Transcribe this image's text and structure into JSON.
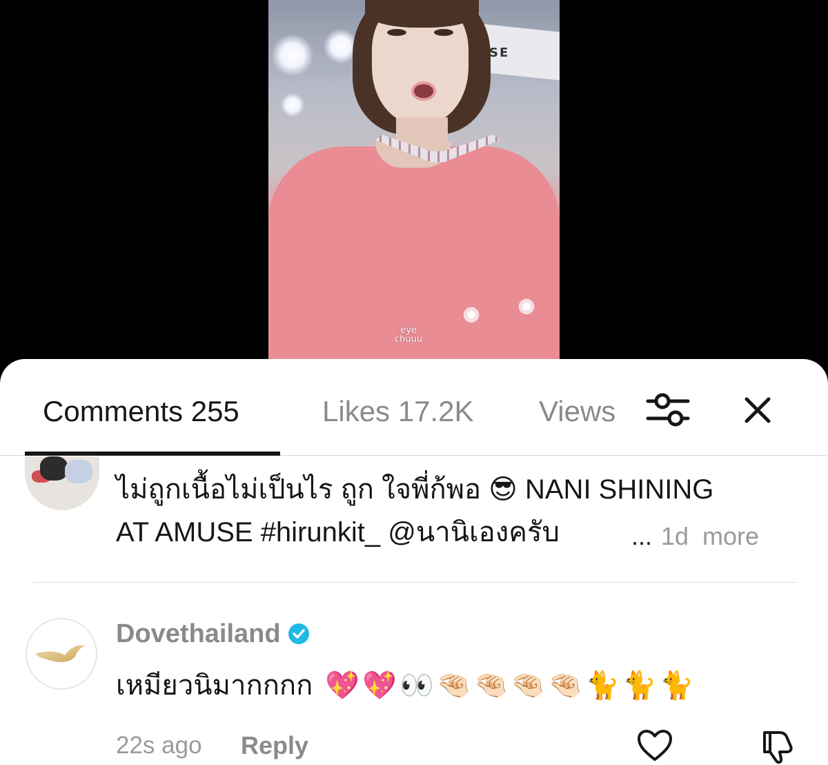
{
  "video": {
    "watermark_top": "eye",
    "watermark_bottom": "chuuu",
    "banner_text": "SE"
  },
  "tabs": [
    {
      "label": "Comments 255",
      "active": true
    },
    {
      "label": "Likes 17.2K",
      "active": false
    },
    {
      "label": "Views",
      "active": false
    }
  ],
  "icons": {
    "filter": "sliders-icon",
    "close": "close-icon",
    "verified": "verified-badge-icon",
    "like": "heart-icon",
    "dislike": "thumbs-down-icon"
  },
  "colors": {
    "text_primary": "#161616",
    "text_secondary": "#8a8a8a",
    "verified_blue": "#20b9e5",
    "sheet_bg": "#ffffff"
  },
  "comments": [
    {
      "text_line1": "ไม่ถูกเนื้อไม่เป็นไร ถูก ใจพี่ก้พอ 😎 NANI SHINING",
      "text_line2": "AT AMUSE #hirunkit_ @นานิเองครับ",
      "ellipsis": "...",
      "time": "1d",
      "more_label": "more"
    },
    {
      "username": "Dovethailand",
      "verified": true,
      "text": "เหมียวนิมากกกก",
      "emojis": [
        "💖",
        "💖",
        "👀",
        "🤏🏻",
        "🤏🏻",
        "🤏🏻",
        "🤏🏻",
        "🐈",
        "🐈",
        "🐈"
      ],
      "time": "22s ago",
      "reply_label": "Reply"
    }
  ]
}
